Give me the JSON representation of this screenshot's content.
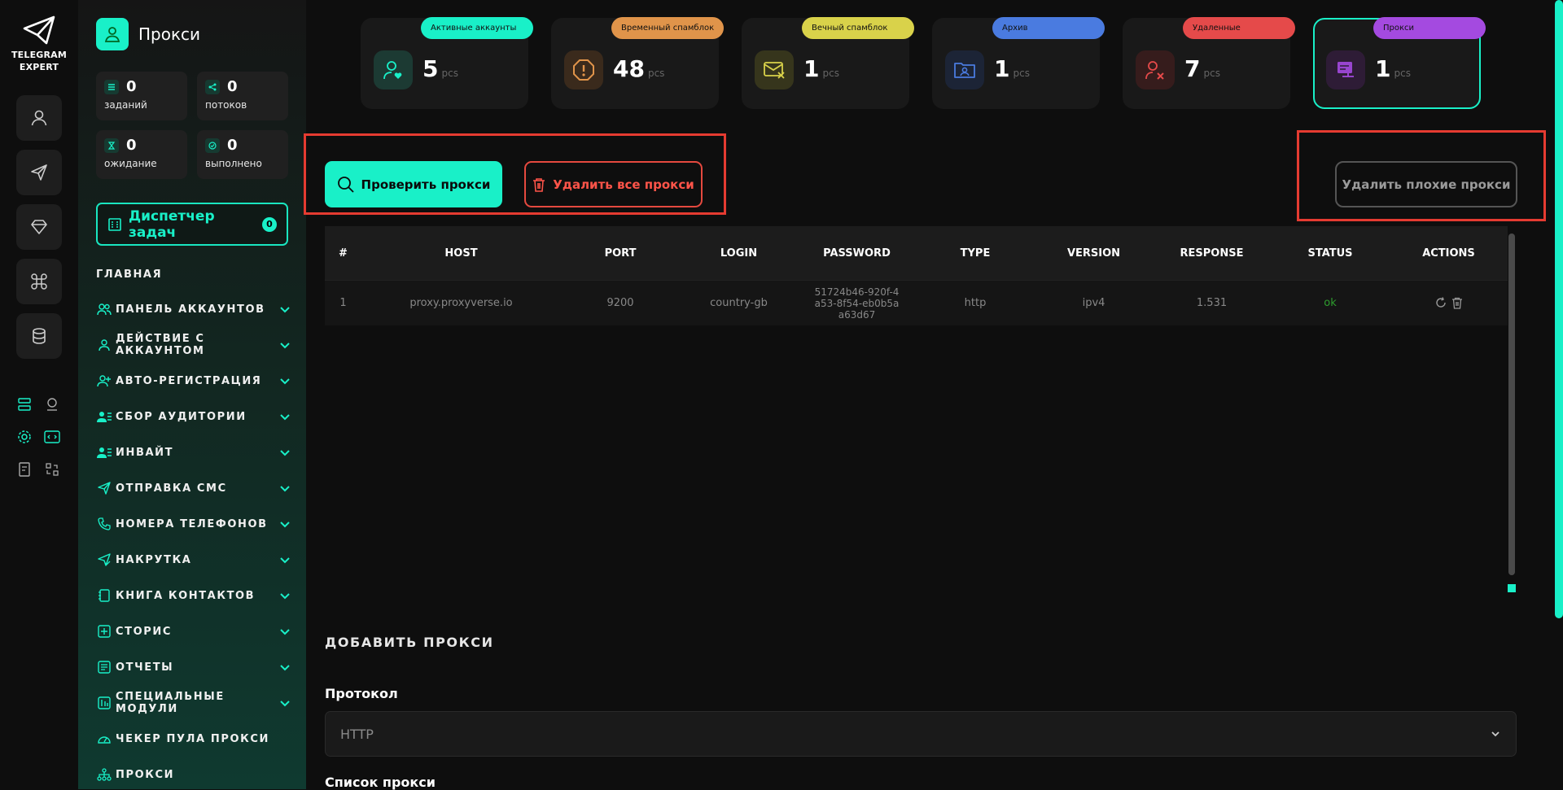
{
  "brand": {
    "line1": "TELEGRAM",
    "line2": "EXPERT"
  },
  "page": {
    "title": "Прокси"
  },
  "stats": [
    {
      "value": "0",
      "label": "заданий",
      "icon": "tasks-icon"
    },
    {
      "value": "0",
      "label": "потоков",
      "icon": "share-icon"
    },
    {
      "value": "0",
      "label": "ожидание",
      "icon": "hourglass-icon"
    },
    {
      "value": "0",
      "label": "выполнено",
      "icon": "check-circle-icon"
    }
  ],
  "task_manager": {
    "label": "Диспетчер задач",
    "count": "0"
  },
  "nav_heading": "ГЛАВНАЯ",
  "nav": [
    {
      "label": "ПАНЕЛЬ АККАУНТОВ"
    },
    {
      "label": "ДЕЙСТВИЕ С АККАУНТОМ"
    },
    {
      "label": "АВТО-РЕГИСТРАЦИЯ"
    },
    {
      "label": "СБОР АУДИТОРИИ"
    },
    {
      "label": "ИНВАЙТ"
    },
    {
      "label": "ОТПРАВКА СМС"
    },
    {
      "label": "НОМЕРА ТЕЛЕФОНОВ"
    },
    {
      "label": "НАКРУТКА"
    },
    {
      "label": "КНИГА КОНТАКТОВ"
    },
    {
      "label": "СТОРИС"
    },
    {
      "label": "ОТЧЕТЫ"
    },
    {
      "label": "СПЕЦИАЛЬНЫЕ МОДУЛИ"
    },
    {
      "label": "ЧЕКЕР ПУЛА ПРОКСИ"
    },
    {
      "label": "ПРОКСИ"
    }
  ],
  "cards": [
    {
      "tag": "Активные аккаунты",
      "value": "5",
      "unit": "pcs",
      "color": "#19f0c8"
    },
    {
      "tag": "Временный спамблок",
      "value": "48",
      "unit": "pcs",
      "color": "#e0944a"
    },
    {
      "tag": "Вечный спамблок",
      "value": "1",
      "unit": "pcs",
      "color": "#d9d24a"
    },
    {
      "tag": "Архив",
      "value": "1",
      "unit": "pcs",
      "color": "#4a7be0"
    },
    {
      "tag": "Удаленные",
      "value": "7",
      "unit": "pcs",
      "color": "#e54a4a"
    },
    {
      "tag": "Прокси",
      "value": "1",
      "unit": "pcs",
      "color": "#a44ae0"
    }
  ],
  "actions": {
    "check": "Проверить прокси",
    "delete_all": "Удалить все прокси",
    "delete_bad": "Удалить плохие прокси"
  },
  "table": {
    "headers": [
      "#",
      "HOST",
      "PORT",
      "LOGIN",
      "PASSWORD",
      "TYPE",
      "VERSION",
      "RESPONSE",
      "STATUS",
      "ACTIONS"
    ],
    "rows": [
      [
        "1",
        "proxy.proxyverse.io",
        "9200",
        "country-gb",
        "51724b46-920f-4a53-8f54-eb0b5aa63d67",
        "http",
        "ipv4",
        "1.531",
        "ok",
        ""
      ]
    ],
    "status_ok_color": "#2e9e2e"
  },
  "add": {
    "title": "ДОБАВИТЬ ПРОКСИ",
    "protocol_label": "Протокол",
    "protocol_value": "HTTP",
    "list_label": "Список прокси"
  }
}
